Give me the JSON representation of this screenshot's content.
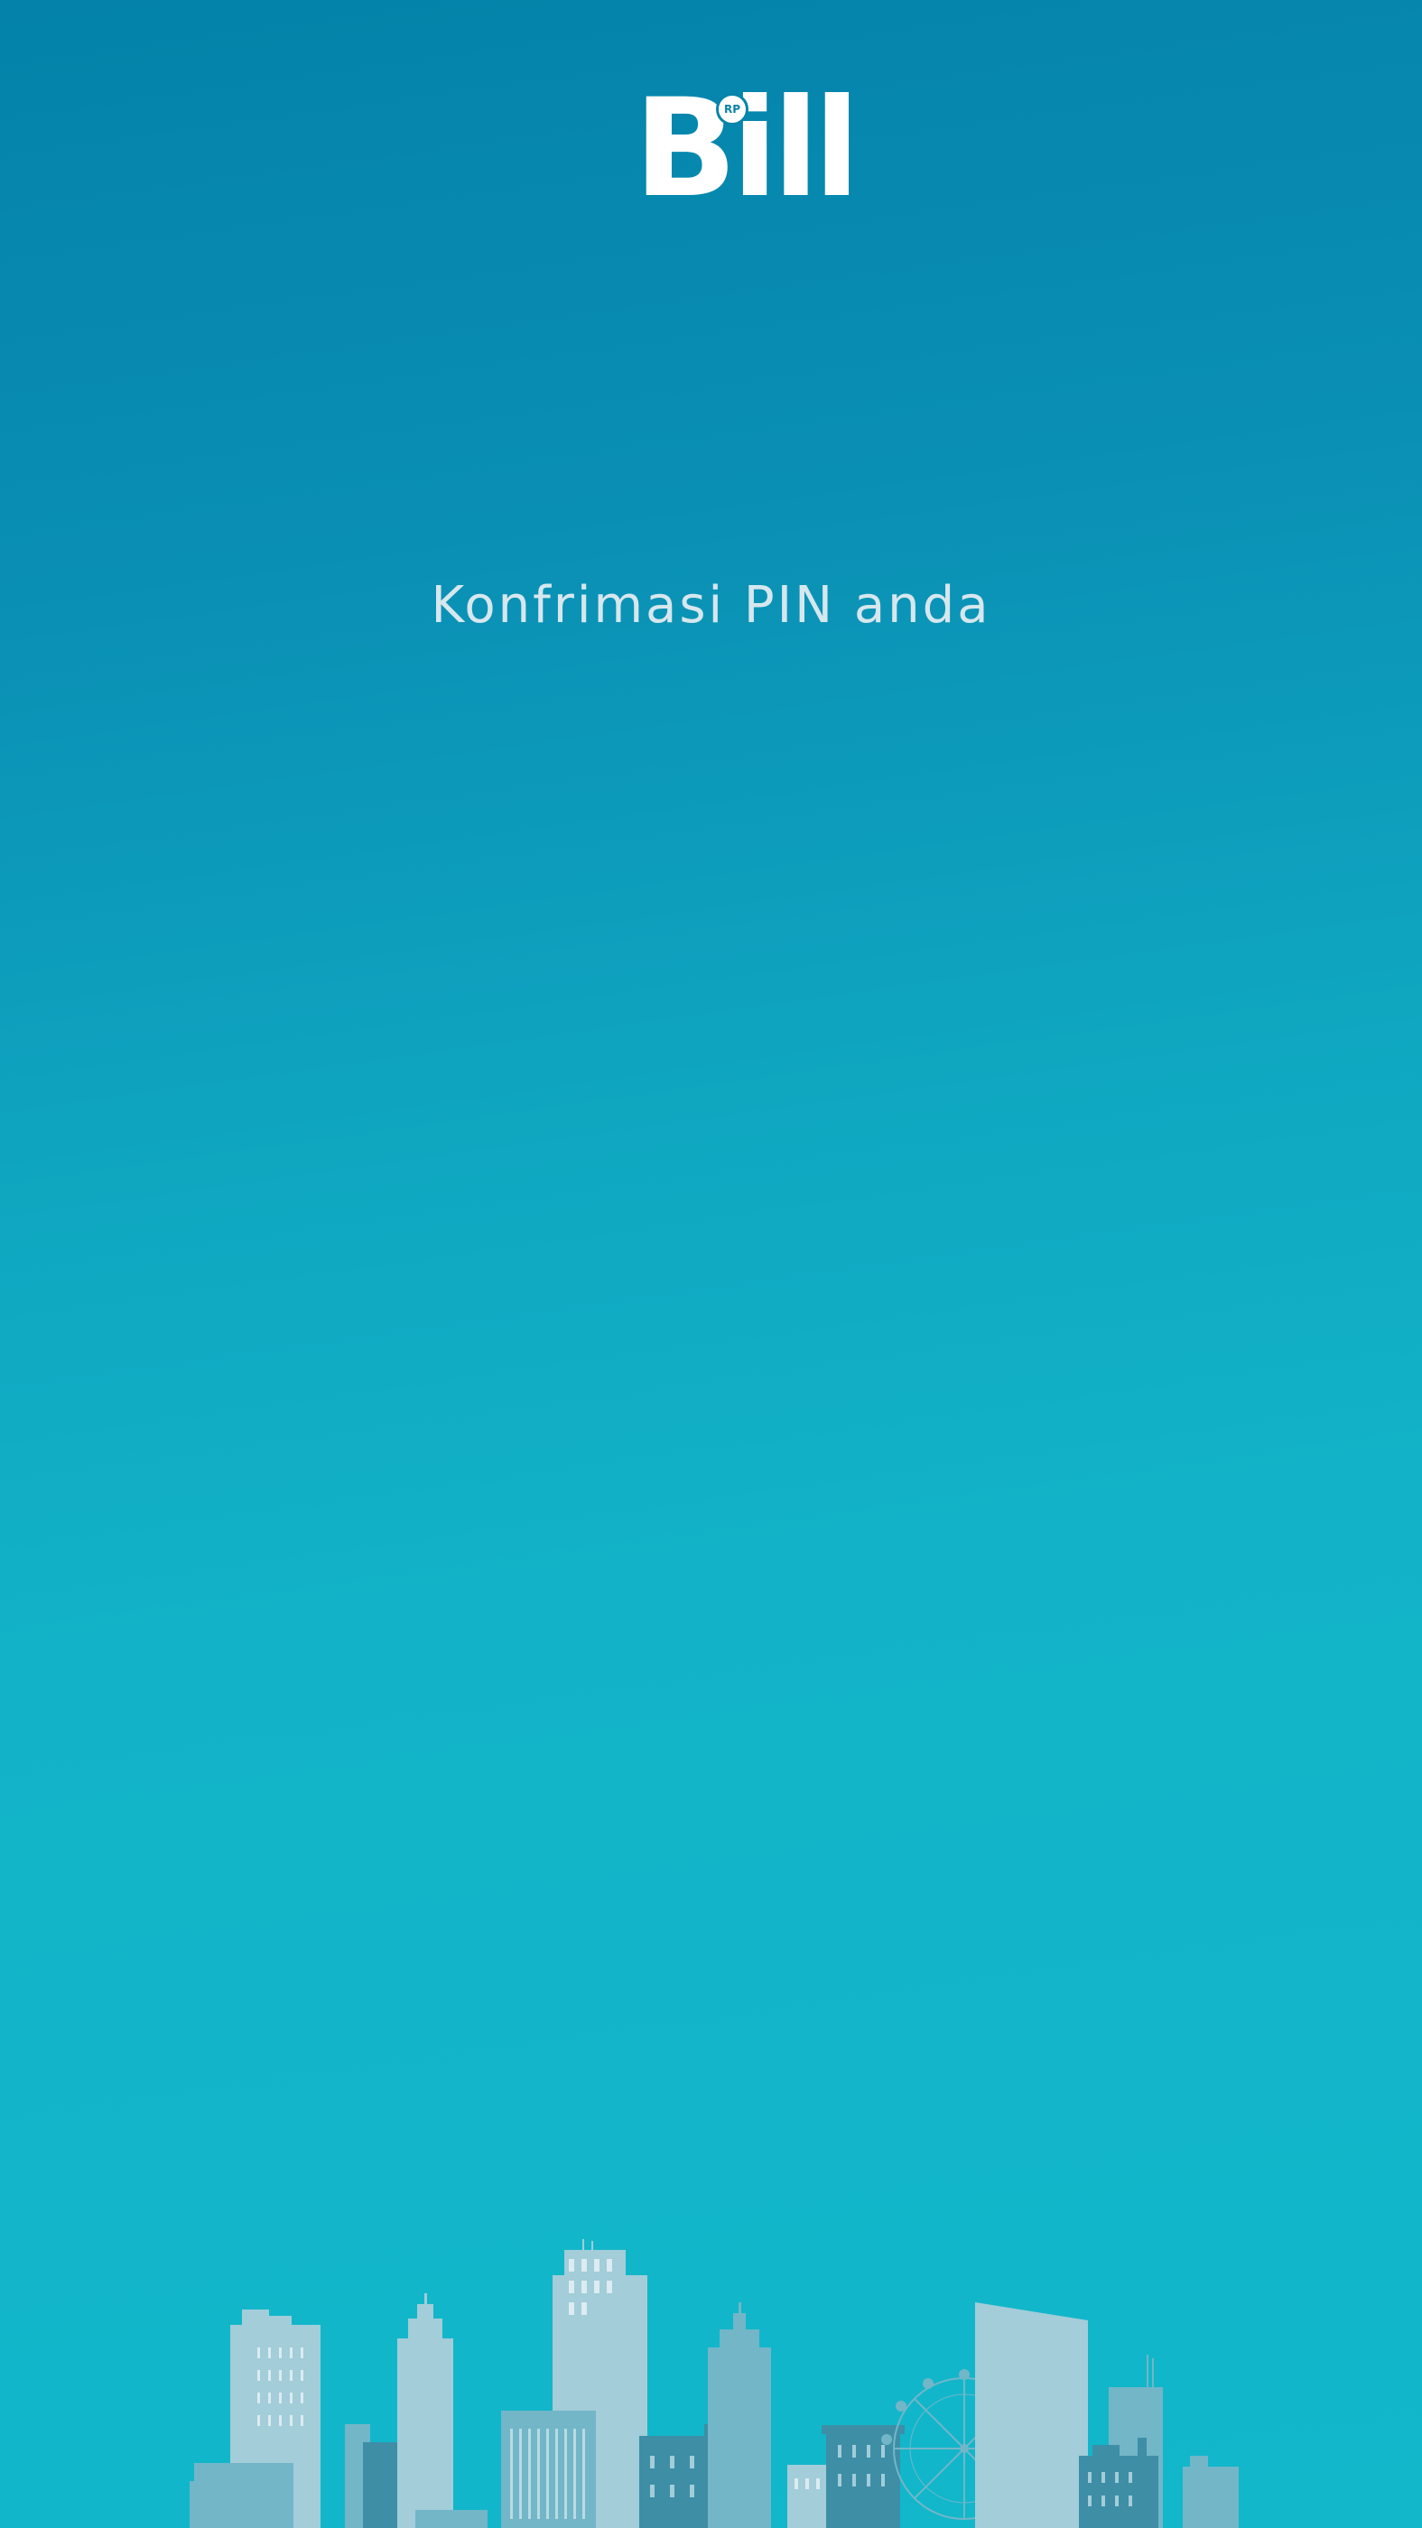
{
  "app": {
    "logo_text": "Bill",
    "logo_badge": "RP"
  },
  "screen": {
    "prompt": "Konfrimasi PIN anda"
  },
  "colors": {
    "gradient_top": "#0482a9",
    "gradient_bottom": "#12b7ca",
    "text_light": "#d6e7ee",
    "skyline_light": "#a2cdd9",
    "skyline_mid": "#72b6c8",
    "skyline_dark": "#3e8ea6"
  },
  "illustration": {
    "name": "city-skyline"
  }
}
